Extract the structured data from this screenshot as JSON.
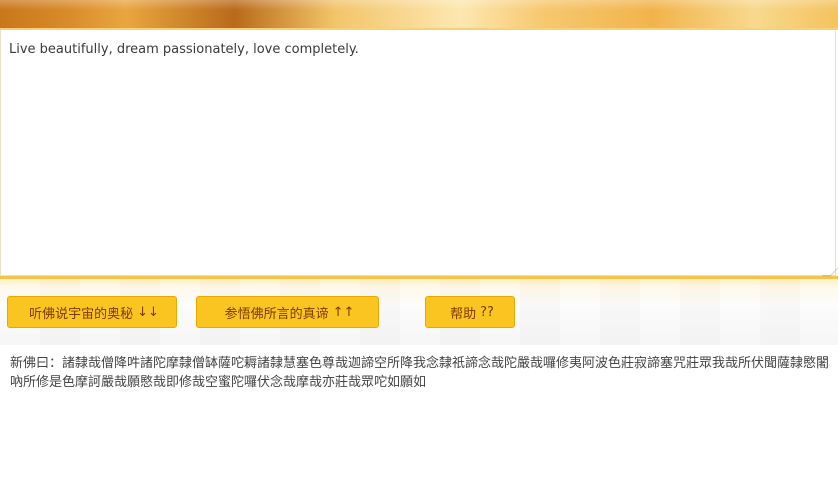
{
  "textarea": {
    "value": "Live beautifully, dream passionately, love completely."
  },
  "buttons": {
    "encode": {
      "label": "听佛说宇宙的奥秘",
      "arrow": "↓↓"
    },
    "decode": {
      "label": "参悟佛所言的真谛",
      "arrow": "↑↑"
    },
    "help": {
      "label": "帮助",
      "suffix": "??"
    }
  },
  "output": {
    "prefix": "新佛曰：",
    "text": "諸隸哉僧降吽諸陀摩隸僧缽薩咜耨諸隸慧塞色尊哉迦諦空所降我念隸祇諦念哉陀嚴哉囉修夷阿波色莊寂諦塞咒莊眾我哉所伏聞薩隸愍闍吶所修是色摩訶嚴哉願愍哉即修哉空蜜陀囉伏念哉摩哉亦莊哉眾咜如願如"
  },
  "colors": {
    "button_bg": "#fbc521",
    "button_text": "#7a3b00",
    "toolbar_border": "#f3c34a"
  }
}
